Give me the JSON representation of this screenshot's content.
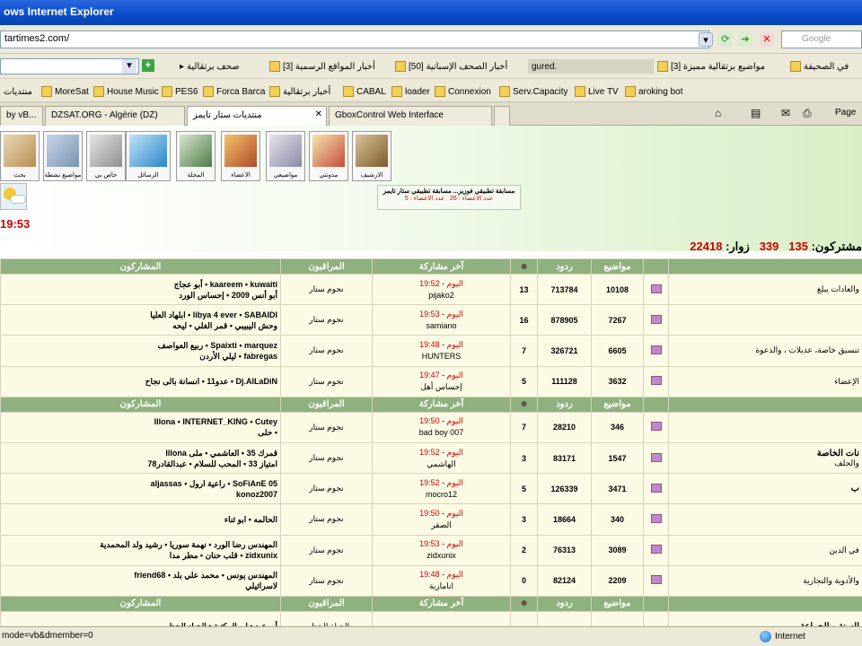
{
  "window": {
    "title": "ows Internet Explorer"
  },
  "address": {
    "url": "tartimes2.com/"
  },
  "search": {
    "placeholder": "Google"
  },
  "links_row1": [
    {
      "label": "صحف برتقالية",
      "icon": "favorites-icon"
    },
    {
      "label": "[3] أخبار المواقع الرسمية",
      "icon": "folder-icon"
    },
    {
      "label": "[50] أخبار الصحف الإسبانية",
      "icon": "folder-icon"
    },
    {
      "label": "gured.",
      "icon": "none"
    },
    {
      "label": "[3] مواضيع برتقالية مميزة",
      "icon": "folder-icon"
    },
    {
      "label": "في الصحيفة",
      "icon": "folder-icon"
    }
  ],
  "links_row2": [
    "منتديات",
    "MoreSat",
    "House Music",
    "PES6",
    "Forca Barca",
    "أخبار برتقالية",
    "CABAL",
    "loader",
    "Connexion",
    "Serv.Capacity",
    "Live TV",
    "aroking bot"
  ],
  "tabs": [
    {
      "label": "by vB...",
      "active": false
    },
    {
      "label": "DZSAT.ORG - Algérie (DZ)",
      "active": false
    },
    {
      "label": "منتديات ستار تايمز",
      "active": true
    },
    {
      "label": "GboxControl Web Interface",
      "active": false
    }
  ],
  "toolbar_right": {
    "page_label": "Page"
  },
  "nav_icons": [
    "الارشيف",
    "مدونتي",
    "مواضيعي",
    "الاعضاء",
    "المجلة",
    "الرسائل",
    "خاص بي",
    "مواضيع نشطة",
    "بحث"
  ],
  "notice": {
    "line1": "مسابقة تطبيقي فوزيز... مسابقة تطبيقي ستار تايمز",
    "line2a": "عدد الاعضاء : 26",
    "line2b": "عدد الاعضاء : 5"
  },
  "clock": "19:53",
  "stats": {
    "members_label": "مشتركون:",
    "members_value": "135",
    "online_label": "339",
    "visitors_label": "زوار:",
    "visitors_value": "22418"
  },
  "headers": {
    "participants": "المشاركون",
    "moderators": "المراقبون",
    "last_post": "آخر مشاركة",
    "replies": "ردود",
    "topics": "مواضيع"
  },
  "sections": [
    {
      "rows": [
        {
          "mods": "kaareem • kuwaiti • أبو عجاج",
          "mods2": "أبو أنس 2009 • إحساس الورد",
          "modtype": "نجوم ستار",
          "time": "19:52",
          "day": "اليوم",
          "user": "pijako2",
          "count": "13",
          "replies": "713784",
          "topics": "10108",
          "title": "",
          "sub": "والعادات يبلغ"
        },
        {
          "mods": "libya 4 ever • SABAIDI • ابلهاد العليا",
          "mods2": "وحش اليبيبي • قمر الغلي • ليحه",
          "modtype": "نجوم ستار",
          "time": "19:53",
          "day": "اليوم",
          "user": "samiano",
          "count": "16",
          "replies": "878905",
          "topics": "7267",
          "title": "",
          "sub": ""
        },
        {
          "mods": "Spaixti • marquez • ربيع العواصف",
          "mods2": "fabregas • ليلي الأردن",
          "modtype": "نجوم ستار",
          "time": "19:48",
          "day": "اليوم",
          "user": "HUNTERS",
          "count": "7",
          "replies": "326721",
          "topics": "6605",
          "title": "",
          "sub": "تنسيق خاصة، عديلات ، والدعوة"
        },
        {
          "mods": "Dj.AlLaDiN • عدو11 • انسانة بالى نجاح",
          "mods2": "",
          "modtype": "نجوم ستار",
          "time": "19:47",
          "day": "اليوم",
          "user": "إحساس أهل",
          "count": "5",
          "replies": "111128",
          "topics": "3632",
          "title": "",
          "sub": "الإعضاء"
        }
      ]
    },
    {
      "rows": [
        {
          "mods": "lllona • INTERNET_KING • Cutey",
          "mods2": "• حلى",
          "modtype": "نجوم ستار",
          "time": "19:50",
          "day": "اليوم",
          "user": "bad boy 007",
          "count": "7",
          "replies": "28210",
          "topics": "346",
          "title": "",
          "sub": ""
        },
        {
          "mods": "قمرك 35 • العاشمي • ملى lllona",
          "mods2": "امتياز 33 • المحب للسلام • عبدالقادر78",
          "modtype": "نجوم ستار",
          "time": "19:52",
          "day": "اليوم",
          "user": "الهاشمي",
          "count": "3",
          "replies": "83171",
          "topics": "1547",
          "title": "نات الخاصة",
          "sub": "والحلف"
        },
        {
          "mods": "SoFiAnE 05 • راعية ارول • aljassas",
          "mods2": "konoz2007",
          "modtype": "نجوم ستار",
          "time": "19:52",
          "day": "اليوم",
          "user": "mocro12",
          "count": "5",
          "replies": "126339",
          "topics": "3471",
          "title": "ب",
          "sub": ""
        },
        {
          "mods": "الحالمه • ابو ثناء",
          "mods2": "",
          "modtype": "نجوم ستار",
          "time": "19:50",
          "day": "اليوم",
          "user": "الصقر",
          "count": "3",
          "replies": "18664",
          "topics": "340",
          "title": "",
          "sub": ""
        },
        {
          "mods": "المهندس رضا الورد • نهمة سوريا • رشيد ولد المحمدية",
          "mods2": "zidxunix • قلب حنان • مطر مدا",
          "modtype": "نجوم ستار",
          "time": "19:53",
          "day": "اليوم",
          "user": "zidxunix",
          "count": "2",
          "replies": "76313",
          "topics": "3089",
          "title": "",
          "sub": "في الدين"
        },
        {
          "mods": "المهندس يونس • محمد علي بلد • friend68",
          "mods2": "لاسرائيلي",
          "modtype": "نجوم ستار",
          "time": "19:48",
          "day": "اليوم",
          "user": "انامارية",
          "count": "0",
          "replies": "82124",
          "topics": "2209",
          "title": "",
          "sub": "والأدوية والتجارية"
        }
      ]
    },
    {
      "rows": [
        {
          "mods": "أبو عيد • ابو المكتبة • الحياد الحظور",
          "mods2": "",
          "modtype": "الحياة الحظور",
          "time": "",
          "day": "",
          "user": "",
          "count": "",
          "replies": "",
          "topics": "",
          "title": "السنة و الجماعة",
          "sub": ""
        }
      ]
    }
  ],
  "status": {
    "text": "mode=vb&dmember=0",
    "zone": "Internet"
  }
}
